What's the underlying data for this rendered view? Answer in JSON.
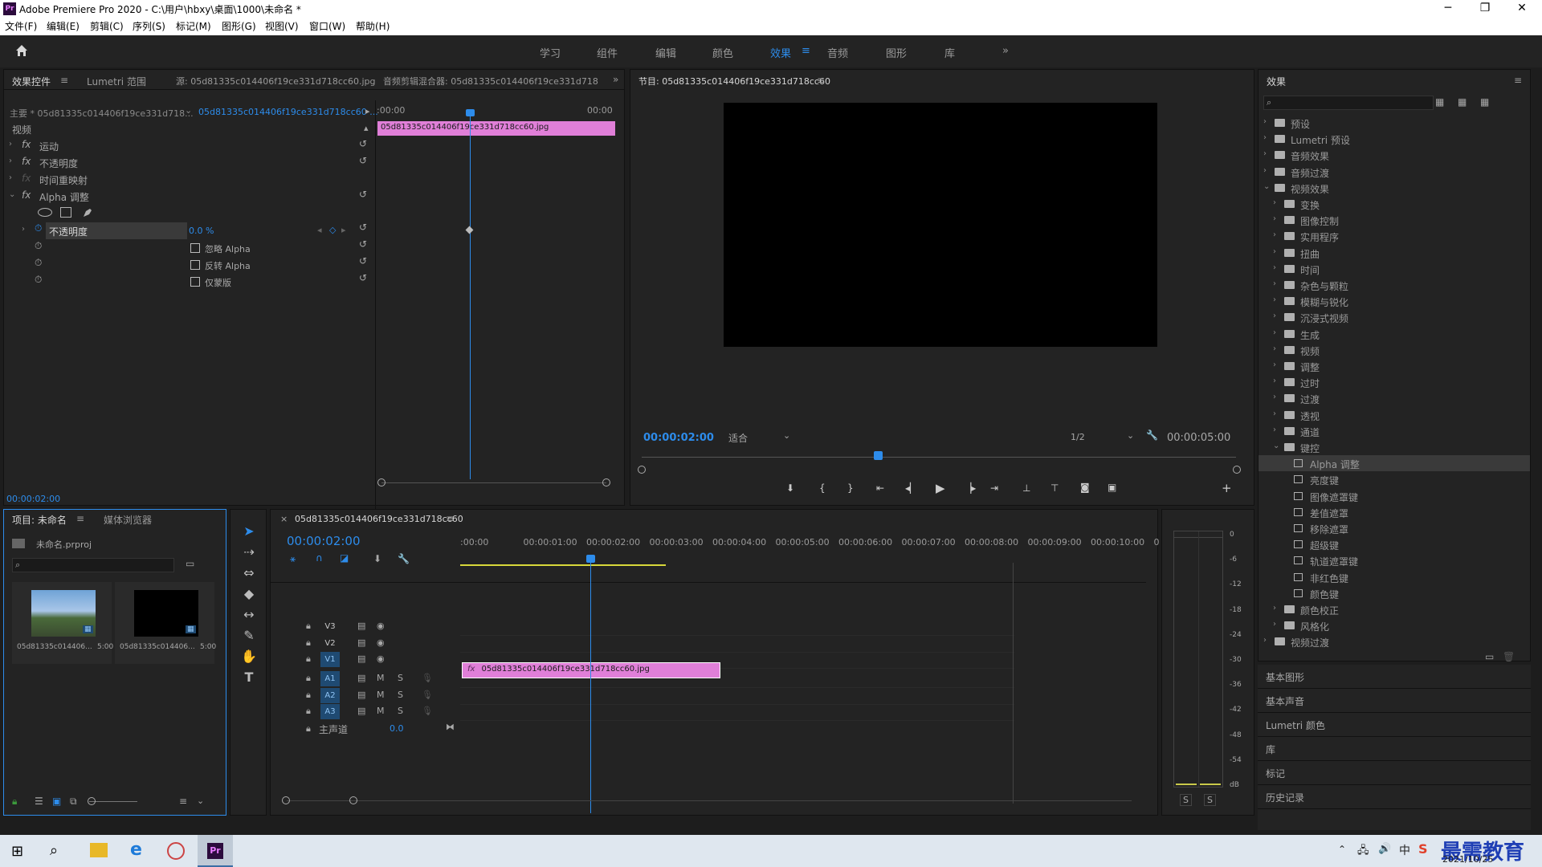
{
  "app": {
    "title": "Adobe Premiere Pro 2020 - C:\\用户\\hbxy\\桌面\\1000\\未命名 *",
    "logo": "Pr",
    "window_buttons": [
      "─",
      "❐",
      "✕"
    ]
  },
  "menu": [
    "文件(F)",
    "编辑(E)",
    "剪辑(C)",
    "序列(S)",
    "标记(M)",
    "图形(G)",
    "视图(V)",
    "窗口(W)",
    "帮助(H)"
  ],
  "workspaces": [
    "学习",
    "组件",
    "编辑",
    "颜色",
    "效果",
    "音频",
    "图形",
    "库"
  ],
  "effect_controls": {
    "tabs": [
      "效果控件",
      "Lumetri 范围",
      "源: 05d81335c014406f19ce331d718cc60.jpg",
      "音频剪辑混合器: 05d81335c014406f19ce331d718"
    ],
    "master": "主要 * 05d81335c014406f19ce331d718...",
    "clip_link": "05d81335c014406f19ce331d718cc60 ...",
    "section": "视频",
    "props": [
      "运动",
      "不透明度",
      "时间重映射",
      "Alpha 调整"
    ],
    "alpha_opacity_label": "不透明度",
    "alpha_opacity_value": "0.0 %",
    "checkboxes": [
      "忽略 Alpha",
      "反转 Alpha",
      "仅蒙版"
    ],
    "ruler_start": ":00:00",
    "ruler_end": "00:00",
    "clip_name": "05d81335c014406f19ce331d718cc60.jpg",
    "timecode": "00:00:02:00"
  },
  "program": {
    "title": "节目: 05d81335c014406f19ce331d718cc60",
    "timecode": "00:00:02:00",
    "fit": "适合",
    "res": "1/2",
    "duration": "00:00:05:00"
  },
  "effects_panel": {
    "title": "效果",
    "items": [
      {
        "label": "预设",
        "level": 0,
        "type": "folder",
        "open": false
      },
      {
        "label": "Lumetri 预设",
        "level": 0,
        "type": "folder",
        "open": false
      },
      {
        "label": "音频效果",
        "level": 0,
        "type": "folder",
        "open": false
      },
      {
        "label": "音频过渡",
        "level": 0,
        "type": "folder",
        "open": false
      },
      {
        "label": "视频效果",
        "level": 0,
        "type": "folder",
        "open": true
      },
      {
        "label": "变换",
        "level": 1,
        "type": "folder",
        "open": false
      },
      {
        "label": "图像控制",
        "level": 1,
        "type": "folder",
        "open": false
      },
      {
        "label": "实用程序",
        "level": 1,
        "type": "folder",
        "open": false
      },
      {
        "label": "扭曲",
        "level": 1,
        "type": "folder",
        "open": false
      },
      {
        "label": "时间",
        "level": 1,
        "type": "folder",
        "open": false
      },
      {
        "label": "杂色与颗粒",
        "level": 1,
        "type": "folder",
        "open": false
      },
      {
        "label": "模糊与锐化",
        "level": 1,
        "type": "folder",
        "open": false
      },
      {
        "label": "沉浸式视频",
        "level": 1,
        "type": "folder",
        "open": false
      },
      {
        "label": "生成",
        "level": 1,
        "type": "folder",
        "open": false
      },
      {
        "label": "视频",
        "level": 1,
        "type": "folder",
        "open": false
      },
      {
        "label": "调整",
        "level": 1,
        "type": "folder",
        "open": false
      },
      {
        "label": "过时",
        "level": 1,
        "type": "folder",
        "open": false
      },
      {
        "label": "过渡",
        "level": 1,
        "type": "folder",
        "open": false
      },
      {
        "label": "透视",
        "level": 1,
        "type": "folder",
        "open": false
      },
      {
        "label": "通道",
        "level": 1,
        "type": "folder",
        "open": false
      },
      {
        "label": "键控",
        "level": 1,
        "type": "folder",
        "open": true
      },
      {
        "label": "Alpha 调整",
        "level": 2,
        "type": "effect",
        "selected": true
      },
      {
        "label": "亮度键",
        "level": 2,
        "type": "effect"
      },
      {
        "label": "图像遮罩键",
        "level": 2,
        "type": "effect"
      },
      {
        "label": "差值遮罩",
        "level": 2,
        "type": "effect"
      },
      {
        "label": "移除遮罩",
        "level": 2,
        "type": "effect"
      },
      {
        "label": "超级键",
        "level": 2,
        "type": "effect"
      },
      {
        "label": "轨道遮罩键",
        "level": 2,
        "type": "effect"
      },
      {
        "label": "非红色键",
        "level": 2,
        "type": "effect"
      },
      {
        "label": "颜色键",
        "level": 2,
        "type": "effect"
      },
      {
        "label": "颜色校正",
        "level": 1,
        "type": "folder",
        "open": false
      },
      {
        "label": "风格化",
        "level": 1,
        "type": "folder",
        "open": false
      },
      {
        "label": "视频过渡",
        "level": 0,
        "type": "folder",
        "open": false
      }
    ],
    "bottom_panels": [
      "基本图形",
      "基本声音",
      "Lumetri 颜色",
      "库",
      "标记",
      "历史记录"
    ]
  },
  "project": {
    "tabs": [
      "项目: 未命名",
      "媒体浏览器"
    ],
    "file": "未命名.prproj",
    "thumbs": [
      {
        "name": "05d81335c014406...",
        "dur": "5:00"
      },
      {
        "name": "05d81335c014406...",
        "dur": "5:00"
      }
    ]
  },
  "timeline": {
    "tab": "05d81335c014406f19ce331d718cc60",
    "timecode": "00:00:02:00",
    "ruler": [
      ":00:00",
      "00:00:01:00",
      "00:00:02:00",
      "00:00:03:00",
      "00:00:04:00",
      "00:00:05:00",
      "00:00:06:00",
      "00:00:07:00",
      "00:00:08:00",
      "00:00:09:00",
      "00:00:10:00",
      "0"
    ],
    "video_tracks": [
      "V3",
      "V2",
      "V1"
    ],
    "audio_tracks": [
      "A1",
      "A2",
      "A3"
    ],
    "master": "主声道",
    "master_val": "0.0",
    "clip": "05d81335c014406f19ce331d718cc60.jpg",
    "fx": "fx"
  },
  "meter": {
    "labels": [
      "0",
      "-6",
      "-12",
      "-18",
      "-24",
      "-30",
      "-36",
      "-42",
      "-48",
      "-54",
      "dB"
    ],
    "solo": [
      "S",
      "S"
    ]
  },
  "taskbar": {
    "date": "2021/10/25",
    "watermark": "最需教育",
    "ime": "中"
  }
}
